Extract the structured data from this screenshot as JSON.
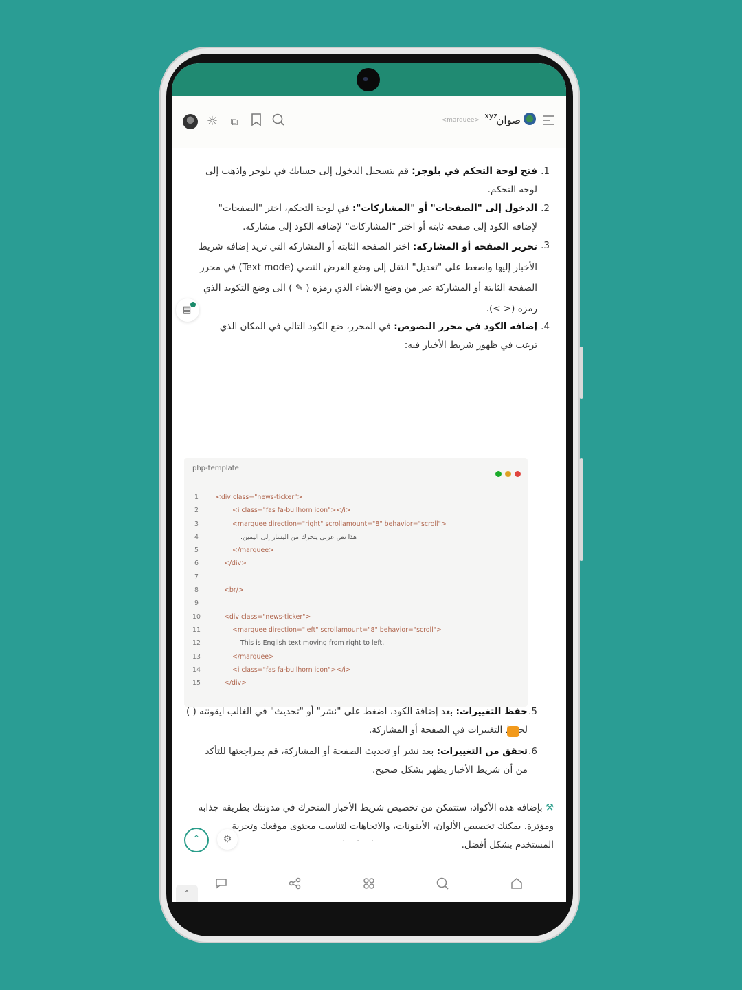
{
  "header": {
    "logo_text": "صوان",
    "logo_suffix": "xyz",
    "marquee_tag": "<marquee>",
    "icons": [
      "menu-icon",
      "globe-logo-icon",
      "search-icon",
      "bookmark-icon",
      "translate-icon",
      "brightness-icon",
      "avatar"
    ]
  },
  "article": {
    "step1_num": "1.",
    "step1_title": "فتح لوحة التحكم في بلوجر:",
    "step1_text": "قم بتسجيل الدخول إلى حسابك في بلوجر واذهب إلى لوحة التحكم.",
    "step2_num": "2.",
    "step2_title": "الدخول إلى \"الصفحات\" أو \"المشاركات\":",
    "step2_text": "في لوحة التحكم، اختر \"الصفحات\" لإضافة الكود إلى صفحة ثابتة أو اختر \"المشاركات\" لإضافة الكود إلى مشاركة.",
    "step3_num": "3.",
    "step3_title": "تحرير الصفحة أو المشاركة:",
    "step3_text": "اختر الصفحة الثابتة أو المشاركة التي تريد إضافة شريط الأخبار إليها واضغط على \"تعديل\" انتقل إلى وضع العرض النصي (Text mode) في محرر الصفحة الثابتة أو المشاركة غير من وضع الانشاء الذي رمزه ( ✎ ) الى وضع التكويد الذي رمزه (< >).",
    "step4_num": "4.",
    "step4_title": "إضافة الكود في محرر النصوص:",
    "step4_text": "في المحرر، ضع الكود التالي في المكان الذي ترغب في ظهور شريط الأخبار فيه:",
    "step5_num": "5.",
    "step5_title": "حفظ التغييرات:",
    "step5_text": "بعد إضافة الكود، اضغط على \"نشر\" أو \"تحديث\" في الغالب ايقونته ( ) لحفظ التغييرات في الصفحة أو المشاركة.",
    "step6_num": "6.",
    "step6_title": "تحقق من التغييرات:",
    "step6_text": "بعد نشر أو تحديث الصفحة أو المشاركة، قم بمراجعتها للتأكد من أن شريط الأخبار يظهر بشكل صحيح.",
    "closing": "بإضافة هذه الأكواد، ستتمكن من تخصيص شريط الأخبار المتحرك في مدونتك بطريقة جذابة ومؤثرة. يمكنك تخصيص الألوان، الأيقونات، والاتجاهات لتناسب محتوى موقعك وتجربة المستخدم بشكل أفضل."
  },
  "code_block": {
    "language": "php-template",
    "dot_colors": [
      "#e0443e",
      "#dea123",
      "#1aab29"
    ],
    "lines": [
      {
        "n": "1",
        "text": "<div class=\"news-ticker\">",
        "indent": 0
      },
      {
        "n": "2",
        "text": "<i class=\"fas fa-bullhorn icon\"></i>",
        "indent": 2
      },
      {
        "n": "3",
        "text": "<marquee direction=\"right\" scrollamount=\"8\" behavior=\"scroll\">",
        "indent": 2
      },
      {
        "n": "4",
        "text": "هذا نص عربي يتحرك من اليسار إلى اليمين.",
        "indent": 3
      },
      {
        "n": "5",
        "text": "</marquee>",
        "indent": 2
      },
      {
        "n": "6",
        "text": "</div>",
        "indent": 1
      },
      {
        "n": "7",
        "text": "",
        "indent": 0
      },
      {
        "n": "8",
        "text": "<br/>",
        "indent": 1
      },
      {
        "n": "9",
        "text": "",
        "indent": 0
      },
      {
        "n": "10",
        "text": "<div class=\"news-ticker\">",
        "indent": 1
      },
      {
        "n": "11",
        "text": "<marquee direction=\"left\" scrollamount=\"8\" behavior=\"scroll\">",
        "indent": 2
      },
      {
        "n": "12",
        "text": "This is English text moving from right to left.",
        "indent": 3
      },
      {
        "n": "13",
        "text": "</marquee>",
        "indent": 2
      },
      {
        "n": "14",
        "text": "<i class=\"fas fa-bullhorn icon\"></i>",
        "indent": 2
      },
      {
        "n": "15",
        "text": "</div>",
        "indent": 1
      }
    ]
  },
  "ellipsis": "· · ·",
  "bottom_nav": [
    "chat-icon",
    "share-icon",
    "apps-icon",
    "search-icon",
    "home-icon"
  ]
}
